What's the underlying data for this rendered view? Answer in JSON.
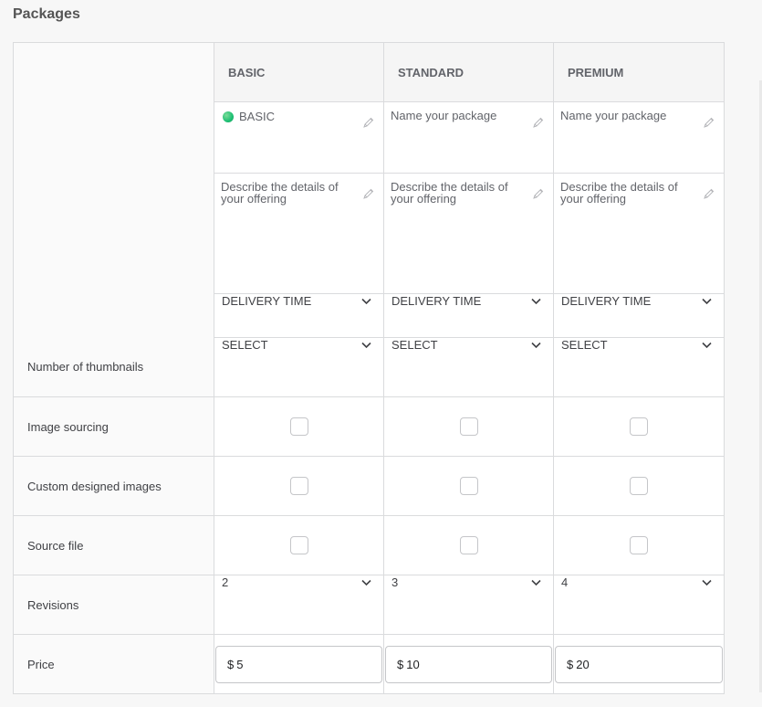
{
  "title": "Packages",
  "packages": [
    {
      "header": "BASIC",
      "name": "BASIC",
      "name_filled": true,
      "description_placeholder": "Describe the details of your offering",
      "delivery": "DELIVERY TIME",
      "thumbnails": "SELECT",
      "image_sourcing": false,
      "custom_designed_images": false,
      "source_file": false,
      "revisions": "2",
      "currency": "$",
      "price": "5"
    },
    {
      "header": "STANDARD",
      "name": "Name your package",
      "name_filled": false,
      "description_placeholder": "Describe the details of your offering",
      "delivery": "DELIVERY TIME",
      "thumbnails": "SELECT",
      "image_sourcing": false,
      "custom_designed_images": false,
      "source_file": false,
      "revisions": "3",
      "currency": "$",
      "price": "10"
    },
    {
      "header": "PREMIUM",
      "name": "Name your package",
      "name_filled": false,
      "description_placeholder": "Describe the details of your offering",
      "delivery": "DELIVERY TIME",
      "thumbnails": "SELECT",
      "image_sourcing": false,
      "custom_designed_images": false,
      "source_file": false,
      "revisions": "4",
      "currency": "$",
      "price": "20"
    }
  ],
  "features": {
    "thumbnails": "Number of thumbnails",
    "image_sourcing": "Image sourcing",
    "custom_designed_images": "Custom designed images",
    "source_file": "Source file",
    "revisions": "Revisions",
    "price": "Price"
  },
  "icons": {
    "edit": "pencil-icon",
    "dropdown": "chevron-down-icon",
    "status": "green-dot-icon"
  },
  "colors": {
    "accent": "#1dbf73",
    "border": "#dadbdd",
    "background": "#f7f7f7"
  }
}
